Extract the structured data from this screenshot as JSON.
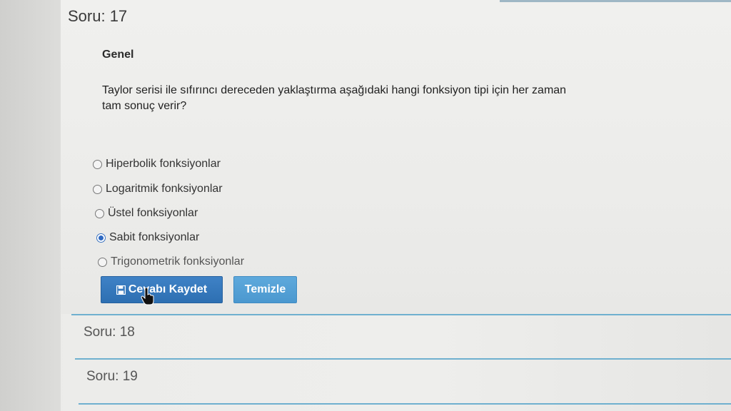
{
  "question": {
    "header": "Soru: 17",
    "section": "Genel",
    "text_line1": "Taylor serisi ile sıfırıncı dereceden yaklaştırma aşağıdaki hangi fonksiyon tipi için her zaman",
    "text_line2": "tam sonuç verir?",
    "options": [
      {
        "label": "Hiperbolik fonksiyonlar",
        "selected": false
      },
      {
        "label": "Logaritmik fonksiyonlar",
        "selected": false
      },
      {
        "label": "Üstel fonksiyonlar",
        "selected": false
      },
      {
        "label": "Sabit fonksiyonlar",
        "selected": true
      },
      {
        "label": "Trigonometrik fonksiyonlar",
        "selected": false
      }
    ]
  },
  "buttons": {
    "save_label": "Cevabı Kaydet",
    "clear_label": "Temizle"
  },
  "next_questions": [
    {
      "header": "Soru: 18"
    },
    {
      "header": "Soru: 19"
    }
  ],
  "colors": {
    "save_button": "#2d6fb2",
    "clear_button": "#4b98cf",
    "divider": "#6fb0cf"
  },
  "icons": {
    "save": "floppy-disk-icon",
    "cursor": "hand-pointer-icon"
  }
}
